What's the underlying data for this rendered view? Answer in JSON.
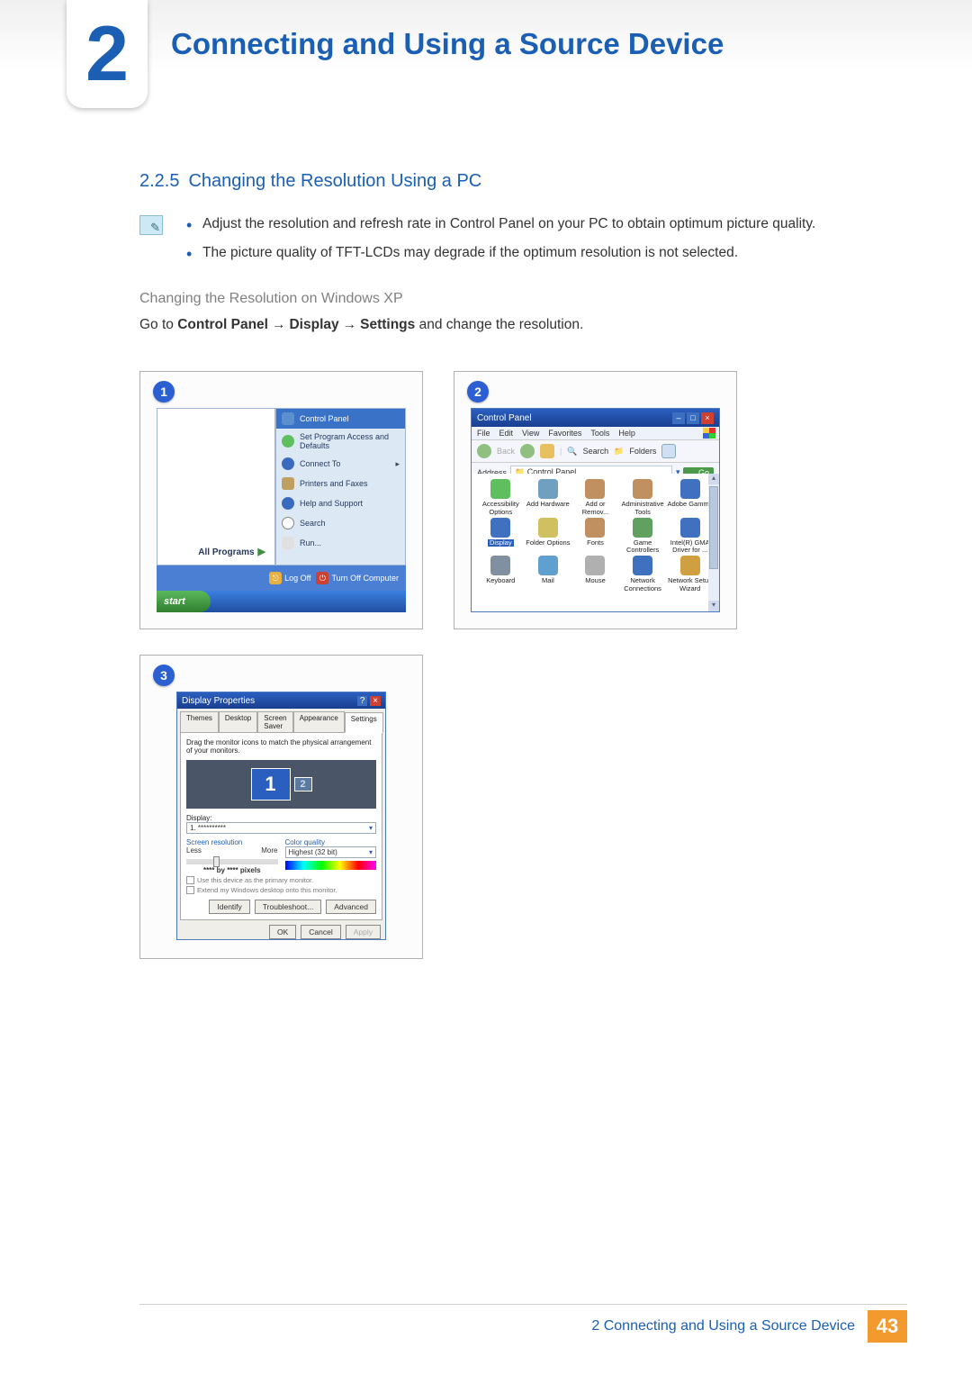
{
  "chapter": {
    "number": "2",
    "title": "Connecting and Using a Source Device"
  },
  "section": {
    "number": "2.2.5",
    "title": "Changing the Resolution Using a PC"
  },
  "notes": [
    "Adjust the resolution and refresh rate in Control Panel on your PC to obtain optimum picture quality.",
    "The picture quality of TFT-LCDs may degrade if the optimum resolution is not selected."
  ],
  "subheading": "Changing the Resolution on Windows XP",
  "instruction": {
    "prefix": "Go to ",
    "path": [
      "Control Panel",
      "Display",
      "Settings"
    ],
    "suffix": " and change the resolution."
  },
  "fig1": {
    "badge": "1",
    "cp": "Control Panel",
    "items": [
      "Set Program Access and Defaults",
      "Connect To",
      "Printers and Faxes",
      "Help and Support",
      "Search",
      "Run..."
    ],
    "all_programs": "All Programs",
    "logoff": "Log Off",
    "turnoff": "Turn Off Computer",
    "start": "start"
  },
  "fig2": {
    "badge": "2",
    "title": "Control Panel",
    "menus": [
      "File",
      "Edit",
      "View",
      "Favorites",
      "Tools",
      "Help"
    ],
    "toolbar": {
      "back": "Back",
      "search": "Search",
      "folders": "Folders"
    },
    "address_label": "Address",
    "address_value": "Control Panel",
    "go": "Go",
    "icons": [
      {
        "label": "Accessibility Options",
        "color": "#5fbf5f"
      },
      {
        "label": "Add Hardware",
        "color": "#6fa0c0"
      },
      {
        "label": "Add or Remov...",
        "color": "#c09060"
      },
      {
        "label": "Administrative Tools",
        "color": "#c09060"
      },
      {
        "label": "Adobe Gamma",
        "color": "#4070c0"
      },
      {
        "label": "Display",
        "color": "#4070c0",
        "selected": true
      },
      {
        "label": "Folder Options",
        "color": "#d0c060"
      },
      {
        "label": "Fonts",
        "color": "#c09060"
      },
      {
        "label": "Game Controllers",
        "color": "#60a060"
      },
      {
        "label": "Intel(R) GMA Driver for ...",
        "color": "#4070c0"
      },
      {
        "label": "Keyboard",
        "color": "#8090a0"
      },
      {
        "label": "Mail",
        "color": "#60a0d0"
      },
      {
        "label": "Mouse",
        "color": "#b0b0b0"
      },
      {
        "label": "Network Connections",
        "color": "#4070c0"
      },
      {
        "label": "Network Setup Wizard",
        "color": "#d0a040"
      }
    ]
  },
  "fig3": {
    "badge": "3",
    "title": "Display Properties",
    "tabs": [
      "Themes",
      "Desktop",
      "Screen Saver",
      "Appearance",
      "Settings"
    ],
    "active_tab": 4,
    "drag_note": "Drag the monitor icons to match the physical arrangement of your monitors.",
    "mon1": "1",
    "mon2": "2",
    "display_label": "Display:",
    "display_value": "1. **********",
    "res_label": "Screen resolution",
    "res_less": "Less",
    "res_more": "More",
    "res_value": "**** by **** pixels",
    "cq_label": "Color quality",
    "cq_value": "Highest (32 bit)",
    "chk1": "Use this device as the primary monitor.",
    "chk2": "Extend my Windows desktop onto this monitor.",
    "btns": [
      "Identify",
      "Troubleshoot...",
      "Advanced"
    ],
    "footer_btns": [
      "OK",
      "Cancel",
      "Apply"
    ]
  },
  "footer": {
    "text": "2 Connecting and Using a Source Device",
    "page": "43"
  }
}
